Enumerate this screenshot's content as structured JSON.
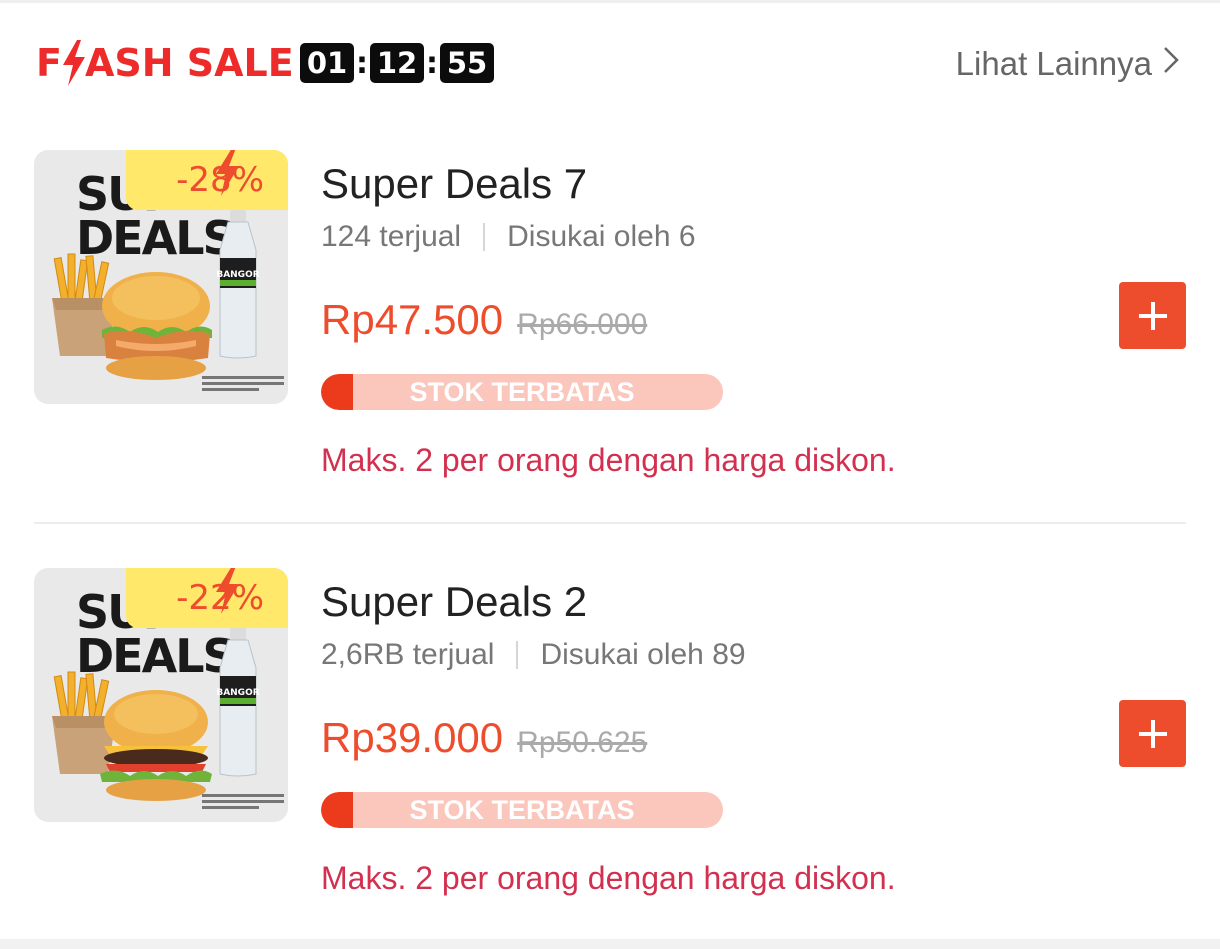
{
  "flash_sale": {
    "title_prefix": "F",
    "title_suffix": "ASH SALE",
    "timer": {
      "hours": "01",
      "minutes": "12",
      "seconds": "55",
      "separator": ":"
    },
    "see_more_label": "Lihat Lainnya",
    "accent_color": "#ee2b2b"
  },
  "products": [
    {
      "name": "Super Deals 7",
      "sold": "124 terjual",
      "likes": "Disukai oleh 6",
      "price": "Rp47.500",
      "original_price": "Rp66.000",
      "discount": "-28%",
      "image_text": [
        "SUPER",
        "DEALS"
      ],
      "bottle_brand": "BANGOR",
      "image_variant": "chicken-burger",
      "stock_label": "STOK TERBATAS",
      "stock_fill": 0.08,
      "limit_note": "Maks. 2 per orang dengan harga diskon."
    },
    {
      "name": "Super Deals 2",
      "sold": "2,6RB terjual",
      "likes": "Disukai oleh 89",
      "price": "Rp39.000",
      "original_price": "Rp50.625",
      "discount": "-22%",
      "image_text": [
        "SUPER",
        "DEALS"
      ],
      "bottle_brand": "BANGOR",
      "image_variant": "beef-burger",
      "stock_label": "STOK TERBATAS",
      "stock_fill": 0.08,
      "limit_note": "Maks. 2 per orang dengan harga diskon."
    }
  ],
  "icons": {
    "bolt": "lightning-bolt-icon",
    "chevron": "chevron-right-icon",
    "add": "plus-icon"
  },
  "colors": {
    "price": "#ee4d2d",
    "add_button": "#ee4d2d",
    "stock_bar_bg": "#fbc6bc",
    "stock_bar_fill": "#ec3a1c",
    "discount_badge": "#ffe86a",
    "limit_text": "#d33050"
  }
}
